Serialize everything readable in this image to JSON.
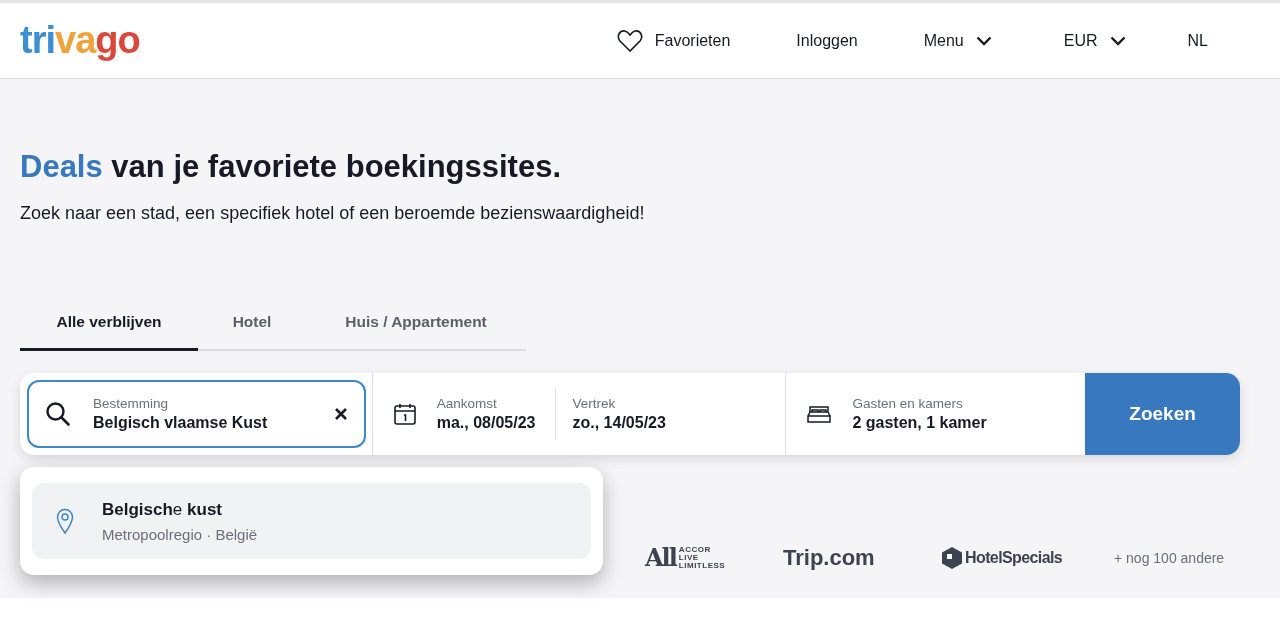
{
  "header": {
    "logo": [
      {
        "text": "tri",
        "color": "#3d8fd1"
      },
      {
        "text": "va",
        "color": "#f0a23b"
      },
      {
        "text": "go",
        "color": "#d9483b"
      }
    ],
    "nav": [
      {
        "label": "Favorieten",
        "kind": "heart"
      },
      {
        "label": "Inloggen",
        "kind": "plain"
      },
      {
        "label": "Menu",
        "kind": "dropdown"
      },
      {
        "label": "EUR",
        "kind": "dropdown"
      },
      {
        "label": "NL",
        "kind": "plain"
      }
    ]
  },
  "hero": {
    "title_highlight": "Deals",
    "title_rest": "van je favoriete boekingssites.",
    "subtitle": "Zoek naar een stad, een specifiek hotel of een beroemde bezienswaardigheid!"
  },
  "tabs": [
    {
      "label": "Alle verblijven",
      "selected": true
    },
    {
      "label": "Hotel",
      "selected": false
    },
    {
      "label": "Huis / Appartement",
      "selected": false
    }
  ],
  "search": {
    "destination": {
      "label": "Bestemming",
      "value": "Belgisch vlaamse Kust"
    },
    "arrival": {
      "label": "Aankomst",
      "value": "ma., 08/05/23"
    },
    "departure": {
      "label": "Vertrek",
      "value": "zo., 14/05/23"
    },
    "guests": {
      "label": "Gasten en kamers",
      "value": "2 gasten, 1 kamer"
    },
    "button": "Zoeken"
  },
  "suggestions": [
    {
      "title": "**Belgisch**e **kust**",
      "subtitle": "Metropoolregio · België",
      "selected": true
    }
  ],
  "partners": {
    "accor": {
      "name": "All",
      "tagline": [
        "ACCOR",
        "LIVE",
        "LIMITLESS"
      ]
    },
    "trip": "Trip.com",
    "hotelspecials": "HotelSpecials",
    "more": "+ nog 100 andere"
  }
}
